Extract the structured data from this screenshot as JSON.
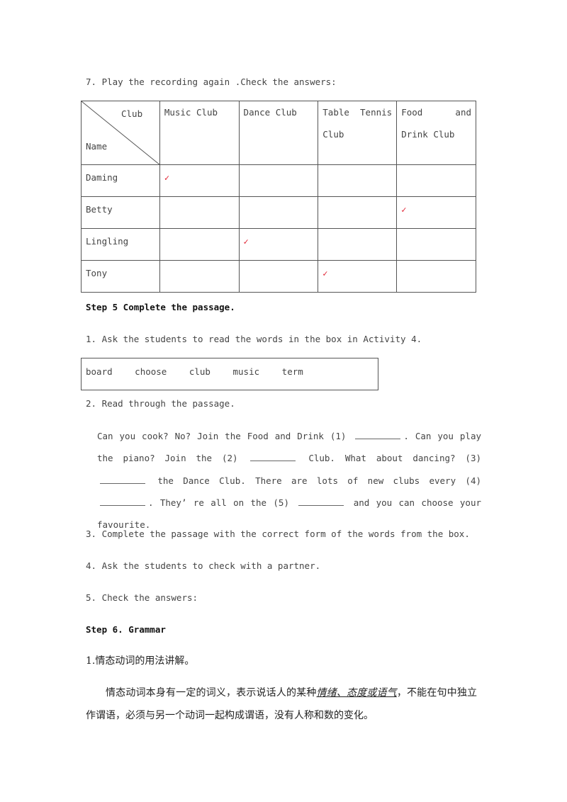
{
  "section7": {
    "title": "7. Play the recording again .Check the answers:"
  },
  "table": {
    "corner_top": "Club",
    "corner_bottom": "Name",
    "columns": [
      {
        "line1": "Music Club",
        "line2": ""
      },
      {
        "line1": "Table",
        "line1b": "Tennis",
        "line2": "Club"
      },
      {
        "line1": "Food",
        "line1b": "and",
        "line2": "Drink Club"
      }
    ],
    "col_dance": "Dance Club",
    "rows": [
      {
        "name": "Daming",
        "checks": [
          "✓",
          "",
          "",
          ""
        ]
      },
      {
        "name": "Betty",
        "checks": [
          "",
          "",
          "",
          "✓"
        ]
      },
      {
        "name": "Lingling",
        "checks": [
          "",
          "✓",
          "",
          ""
        ]
      },
      {
        "name": "Tony",
        "checks": [
          "",
          "",
          "✓",
          ""
        ]
      }
    ],
    "check_color": "#e02030"
  },
  "step5": {
    "title": "Step 5 Complete the passage.",
    "item1": "1. Ask the students to read the words in the box in Activity 4.",
    "words": [
      "board",
      "choose",
      "club",
      "music",
      "term"
    ],
    "item2": "2. Read through the passage.",
    "passage": {
      "p1": "Can you cook? No? Join the Food and Drink (1)",
      "p2": ". Can you play the piano? Join the (2)",
      "p3": "Club. What about dancing? (3)",
      "p4": "the Dance Club. There are lots of new clubs every (4)",
      "p5": ". They’ re all on the (5)",
      "p6": "and you can choose your favourite."
    },
    "item3": "3. Complete the passage with the correct form of the words from the box.",
    "item4": "4. Ask the students to check with a partner.",
    "item5": "5. Check the answers:"
  },
  "step6": {
    "title": "Step 6. Grammar",
    "item1": "1.情态动词的用法讲解。",
    "para_a": "情态动词本身有一定的词义，表示说话人的某种",
    "para_u": "情绪、态度或语气",
    "para_b": "，不能在句中独立作谓语，必须与另一个动词一起构成谓语，没有人称和数的变化。"
  }
}
